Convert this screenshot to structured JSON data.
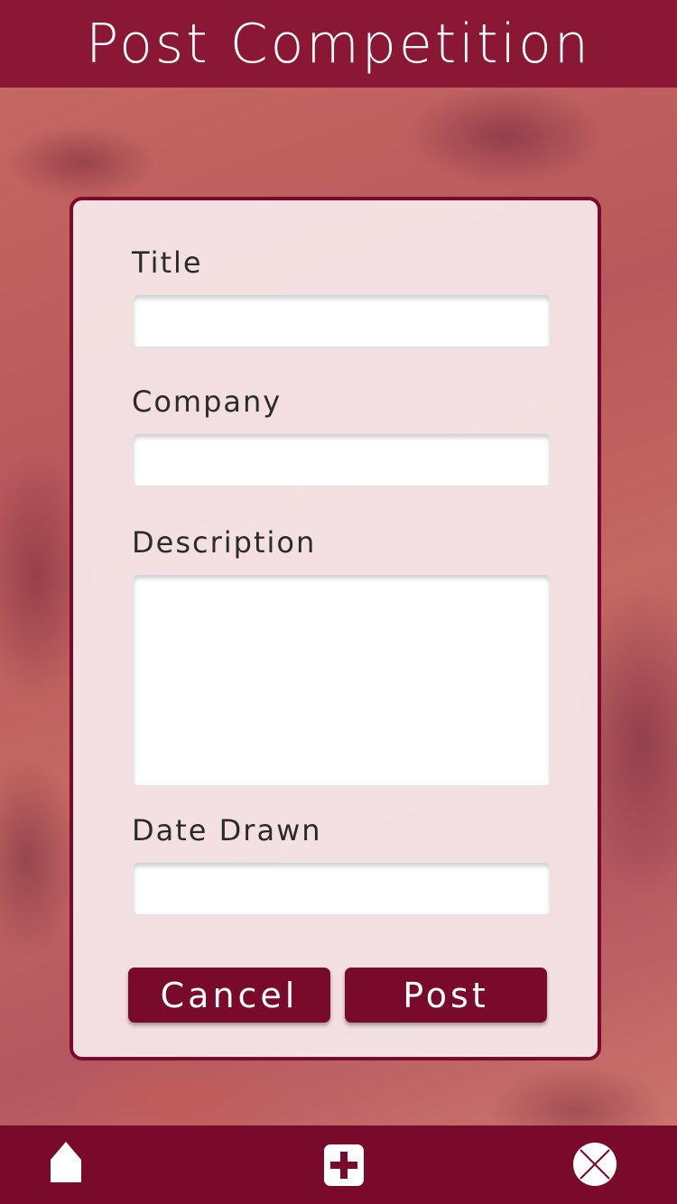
{
  "header": {
    "title": "Post Competition"
  },
  "form": {
    "title_label": "Title",
    "title_value": "",
    "company_label": "Company",
    "company_value": "",
    "description_label": "Description",
    "description_value": "",
    "date_label": "Date Drawn",
    "date_value": ""
  },
  "buttons": {
    "cancel": "Cancel",
    "post": "Post"
  },
  "nav": {
    "items": [
      "home-icon",
      "add-icon",
      "close-icon"
    ]
  },
  "colors": {
    "brand": "#7a0a2c",
    "header": "#8a1733",
    "card": "#f8eaec"
  }
}
